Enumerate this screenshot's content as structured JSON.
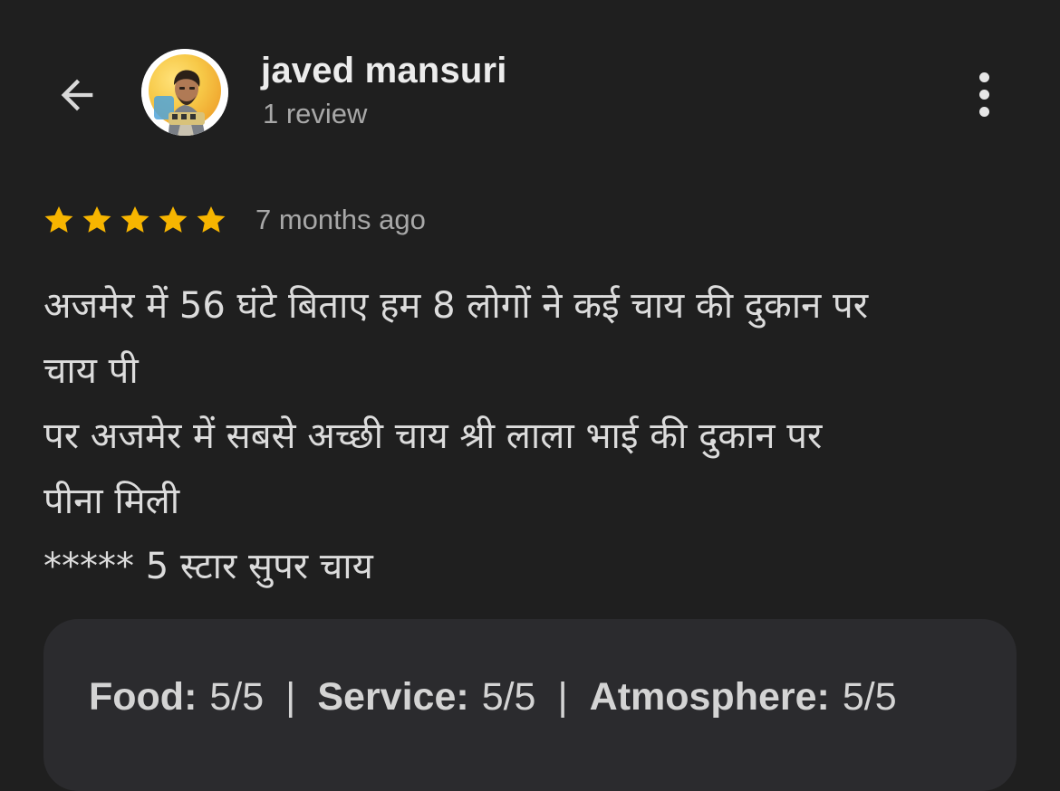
{
  "reviewer": {
    "name": "javed mansuri",
    "review_count": "1 review",
    "back_icon": "arrow-left-icon",
    "more_icon": "more-vert-icon"
  },
  "review": {
    "stars": 5,
    "star_color": "#f7b500",
    "time_ago": "7 months ago",
    "lines": [
      "अजमेर में 56 घंटे बिताए हम 8 लोगों ने कई चाय की दुकान पर",
      "चाय पी",
      "पर अजमेर में सबसे अच्छी चाय श्री लाला भाई की दुकान पर",
      "पीना मिली",
      "***** 5 स्टार सुपर चाय"
    ]
  },
  "attributes": {
    "food_label": "Food:",
    "food_value": "5/5",
    "service_label": "Service:",
    "service_value": "5/5",
    "atmosphere_label": "Atmosphere:",
    "atmosphere_value": "5/5",
    "separator": "|"
  },
  "colors": {
    "background": "#1f1f1f",
    "card": "#2b2b2e",
    "primary_text": "#ececec",
    "secondary_text": "#a8a8a8"
  }
}
